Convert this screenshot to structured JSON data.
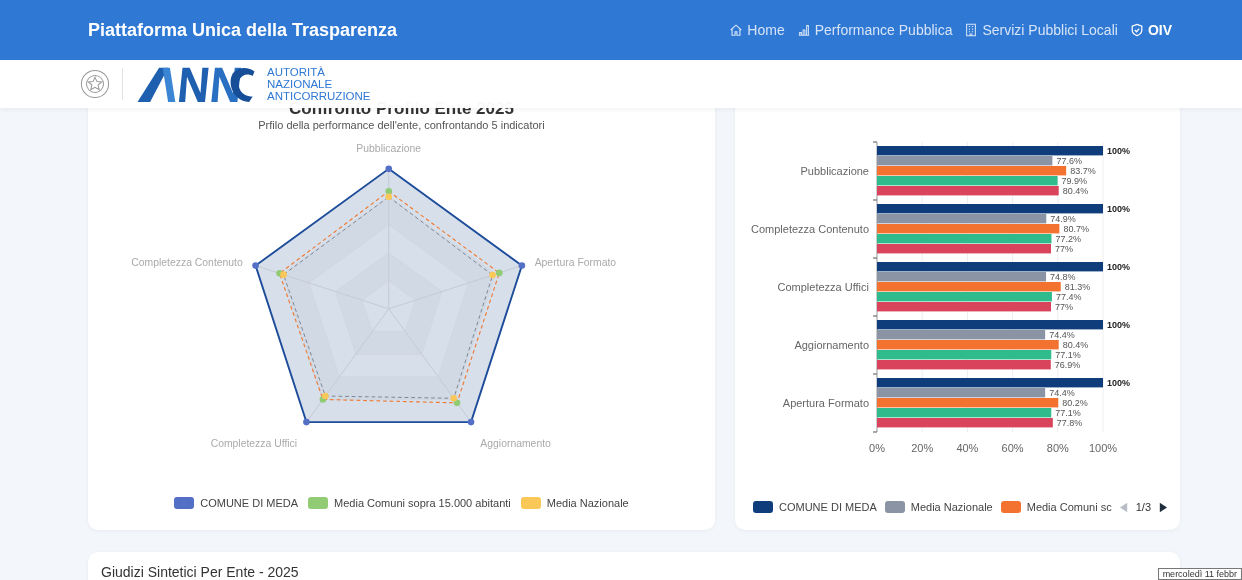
{
  "header": {
    "title": "Piattaforma Unica della Trasparenza",
    "nav": [
      {
        "label": "Home",
        "selected": false
      },
      {
        "label": "Performance Pubblica",
        "selected": false
      },
      {
        "label": "Servizi Pubblici Locali",
        "selected": false
      },
      {
        "label": "OIV",
        "selected": true
      }
    ]
  },
  "logo_bar": {
    "lines": [
      "AUTORITÀ",
      "NAZIONALE",
      "ANTICORRUZIONE"
    ]
  },
  "radar_card": {
    "title": "Confronto Profilo Ente 2025",
    "subtitle": "Prfilo della performance dell'ente, confrontando 5 indicatori",
    "axes": [
      "Pubblicazione",
      "Completezza Contenuto",
      "Apertura Formato",
      "Completezza Uffici",
      "Aggiornamento"
    ],
    "legend": [
      {
        "label": "COMUNE DI MEDA",
        "color": "#5470c6"
      },
      {
        "label": "Media Comuni sopra 15.000 abitanti",
        "color": "#91cc75"
      },
      {
        "label": "Media Nazionale",
        "color": "#fac858"
      }
    ]
  },
  "bar_card": {
    "chart_data": {
      "type": "bar",
      "orientation": "horizontal",
      "categories": [
        "Pubblicazione",
        "Completezza Contenuto",
        "Completezza Uffici",
        "Aggiornamento",
        "Apertura Formato"
      ],
      "series": [
        {
          "name": "COMUNE DI MEDA",
          "color": "#0f3d7c",
          "values": [
            100,
            100,
            100,
            100,
            100
          ]
        },
        {
          "name": "Media Nazionale",
          "color": "#8a94a4",
          "values": [
            77.6,
            74.9,
            74.8,
            74.4,
            74.4
          ]
        },
        {
          "name": "Media Comuni sc",
          "color": "#f47230",
          "values": [
            83.7,
            80.7,
            81.3,
            80.4,
            80.2
          ]
        },
        {
          "color": "#2fbb8c",
          "values": [
            79.9,
            77.2,
            77.4,
            77.1,
            77.1
          ]
        },
        {
          "color": "#d9435b",
          "values": [
            80.4,
            77,
            77,
            76.9,
            77.8
          ]
        }
      ],
      "value_labels": [
        [
          "100%",
          "77.6%",
          "83.7%",
          "79.9%",
          "80.4%"
        ],
        [
          "100%",
          "74.9%",
          "80.7%",
          "77.2%",
          "77%"
        ],
        [
          "100%",
          "74.8%",
          "81.3%",
          "77.4%",
          "77%"
        ],
        [
          "100%",
          "74.4%",
          "80.4%",
          "77.1%",
          "76.9%"
        ],
        [
          "100%",
          "74.4%",
          "80.2%",
          "77.1%",
          "77.8%"
        ]
      ],
      "xlim": [
        0,
        100
      ],
      "grid": true,
      "xticks": [
        {
          "value": 0,
          "label": "0%"
        },
        {
          "value": 20,
          "label": "20%"
        },
        {
          "value": 40,
          "label": "40%"
        },
        {
          "value": 60,
          "label": "60%"
        },
        {
          "value": 80,
          "label": "80%"
        },
        {
          "value": 100,
          "label": "100%"
        }
      ]
    },
    "legend_page": "1/3"
  },
  "section": {
    "title": "Giudizi Sintetici Per Ente - 2025"
  },
  "tooltip": "mercoledì 11 febbr"
}
